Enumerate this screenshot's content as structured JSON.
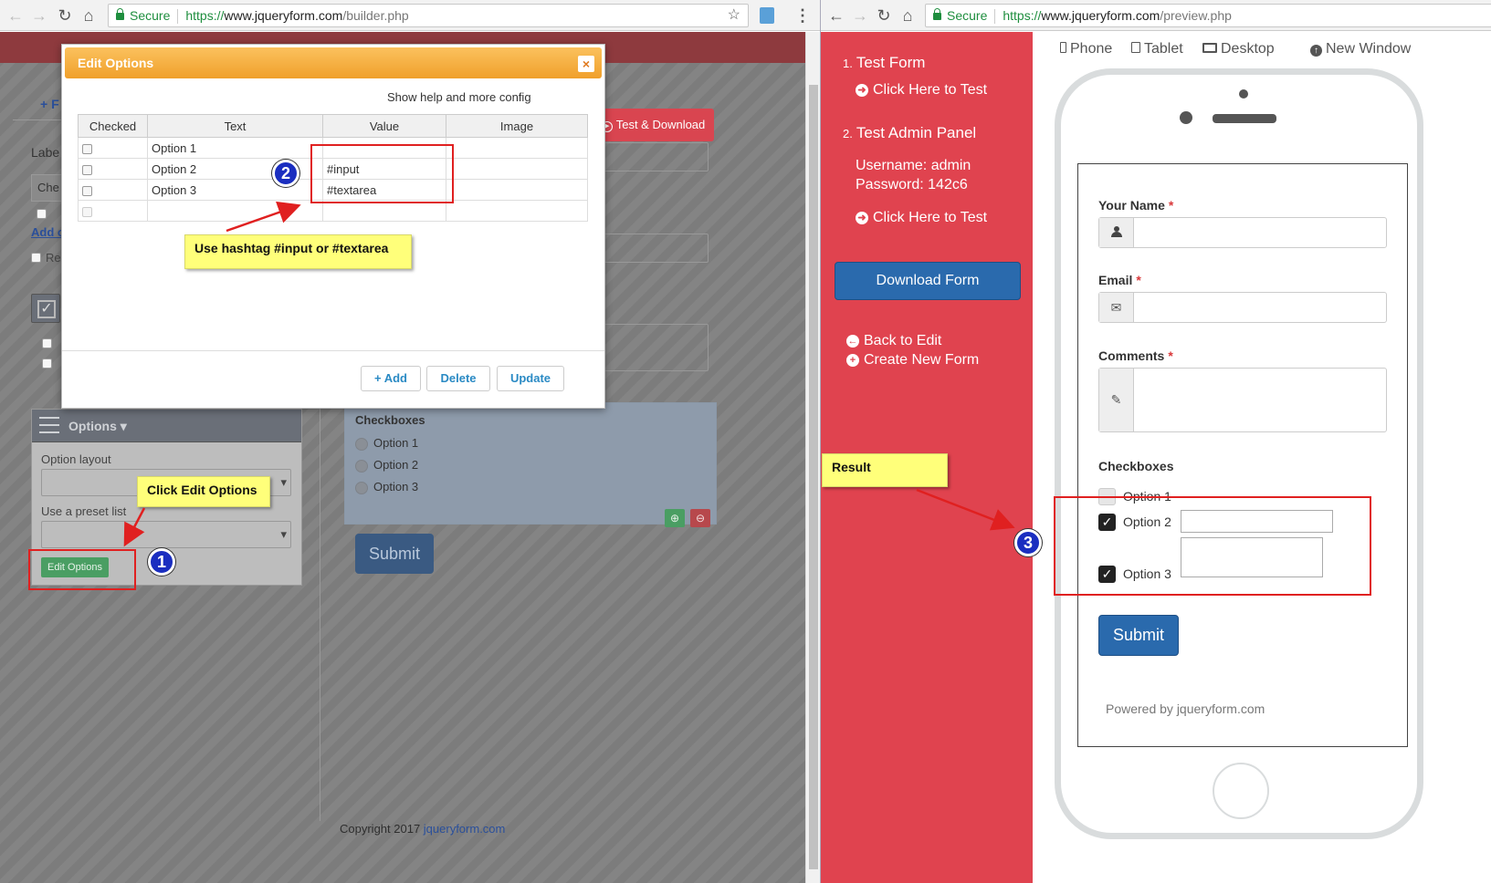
{
  "left_browser": {
    "secure": "Secure",
    "url_scheme": "https://",
    "url_domain": "www.jqueryform.com",
    "url_path": "/builder.php"
  },
  "right_browser": {
    "secure": "Secure",
    "url_scheme": "https://",
    "url_domain": "www.jqueryform.com",
    "url_path": "/preview.php"
  },
  "builder": {
    "modal": {
      "title": "Edit Options",
      "help_link": "Show help and more config",
      "columns": [
        "Checked",
        "Text",
        "Value",
        "Image"
      ],
      "rows": [
        {
          "text": "Option 1",
          "value": ""
        },
        {
          "text": "Option 2",
          "value": "#input"
        },
        {
          "text": "Option 3",
          "value": "#textarea"
        },
        {
          "text": "",
          "value": ""
        }
      ],
      "add_label": "+ Add",
      "delete_label": "Delete",
      "update_label": "Update"
    },
    "test_download_label": "Test & Download",
    "field_label_partial": "Labe",
    "input_partial": "Che",
    "add_link_partial": "Add o",
    "add_field_partial": "+ F",
    "required_partial": "Re",
    "options_panel": {
      "title": "Options",
      "option_layout_label": "Option layout",
      "preset_label": "Use a preset list",
      "edit_button": "Edit Options"
    },
    "checkbox_preview": {
      "title": "Checkboxes",
      "options": [
        "Option 1",
        "Option 2",
        "Option 3"
      ]
    },
    "submit_label": "Submit",
    "copyright_prefix": "Copyright 2017 ",
    "copyright_link": "jqueryform.com",
    "callout_edit": "Click Edit Options",
    "callout_hashtag": "Use hashtag #input or #textarea",
    "badge_1": "1",
    "badge_2": "2"
  },
  "preview": {
    "sidebar": {
      "test_form_num": "1.",
      "test_form": "Test Form",
      "click_test_1": "Click Here to Test",
      "admin_num": "2.",
      "admin_panel": "Test Admin Panel",
      "username": "Username: admin",
      "password": "Password: 142c6",
      "click_test_2": "Click Here to Test",
      "download": "Download Form",
      "back_to_edit": "Back to Edit",
      "create_new": "Create New Form"
    },
    "devices": {
      "phone": "Phone",
      "tablet": "Tablet",
      "desktop": "Desktop",
      "new_window": "New Window"
    },
    "form": {
      "name_label": "Your Name",
      "email_label": "Email",
      "comments_label": "Comments",
      "checkboxes_label": "Checkboxes",
      "options": [
        {
          "label": "Option 1",
          "checked": false
        },
        {
          "label": "Option 2",
          "checked": true
        },
        {
          "label": "Option 3",
          "checked": true
        }
      ],
      "submit": "Submit",
      "powered": "Powered by jqueryform.com"
    },
    "callout_result": "Result",
    "badge_3": "3"
  },
  "colors": {
    "sidebar_red": "#e0434f",
    "primary_blue": "#2a6aad",
    "modal_orange": "#f0a02b",
    "annotation_red": "#e02020",
    "callout_yellow": "#ffff7a"
  }
}
